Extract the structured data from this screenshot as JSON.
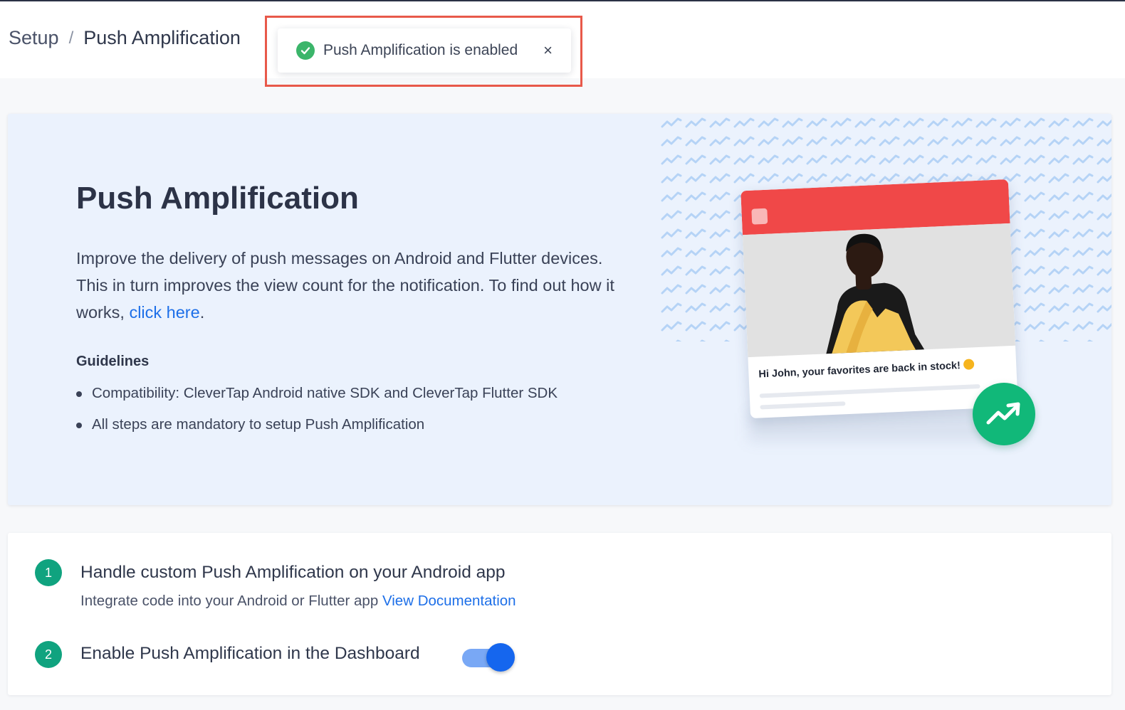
{
  "breadcrumb": {
    "parent": "Setup",
    "separator": "/",
    "current": "Push Amplification"
  },
  "toast": {
    "message": "Push Amplification is enabled",
    "close_label": "×",
    "icon": "check-circle-icon",
    "color": "#3bb56a"
  },
  "hero": {
    "title": "Push Amplification",
    "description_before_link": "Improve the delivery of push messages on Android and Flutter devices. This in turn improves the view count for the notification. To find out how it works, ",
    "link_text": "click here",
    "description_after_link": ".",
    "guidelines_title": "Guidelines",
    "guidelines": [
      "Compatibility: CleverTap Android native SDK and CleverTap Flutter SDK",
      "All steps are mandatory to setup Push Amplification"
    ],
    "illustration": {
      "notification_text": "Hi John,  your favorites are back in stock!",
      "badge_icon": "trending-up-icon",
      "header_color": "#f04848",
      "badge_color": "#11b879"
    }
  },
  "steps": [
    {
      "number": "1",
      "title": "Handle custom Push Amplification on your Android app",
      "subtitle": "Integrate code into your Android or Flutter app ",
      "link_text": "View Documentation"
    },
    {
      "number": "2",
      "title": "Enable Push Amplification in the Dashboard",
      "toggle_on": true
    }
  ],
  "colors": {
    "accent": "#1d6fe8",
    "step_badge": "#10a37f",
    "hero_background": "#ebf2fd",
    "highlight_border": "#e8594a"
  }
}
